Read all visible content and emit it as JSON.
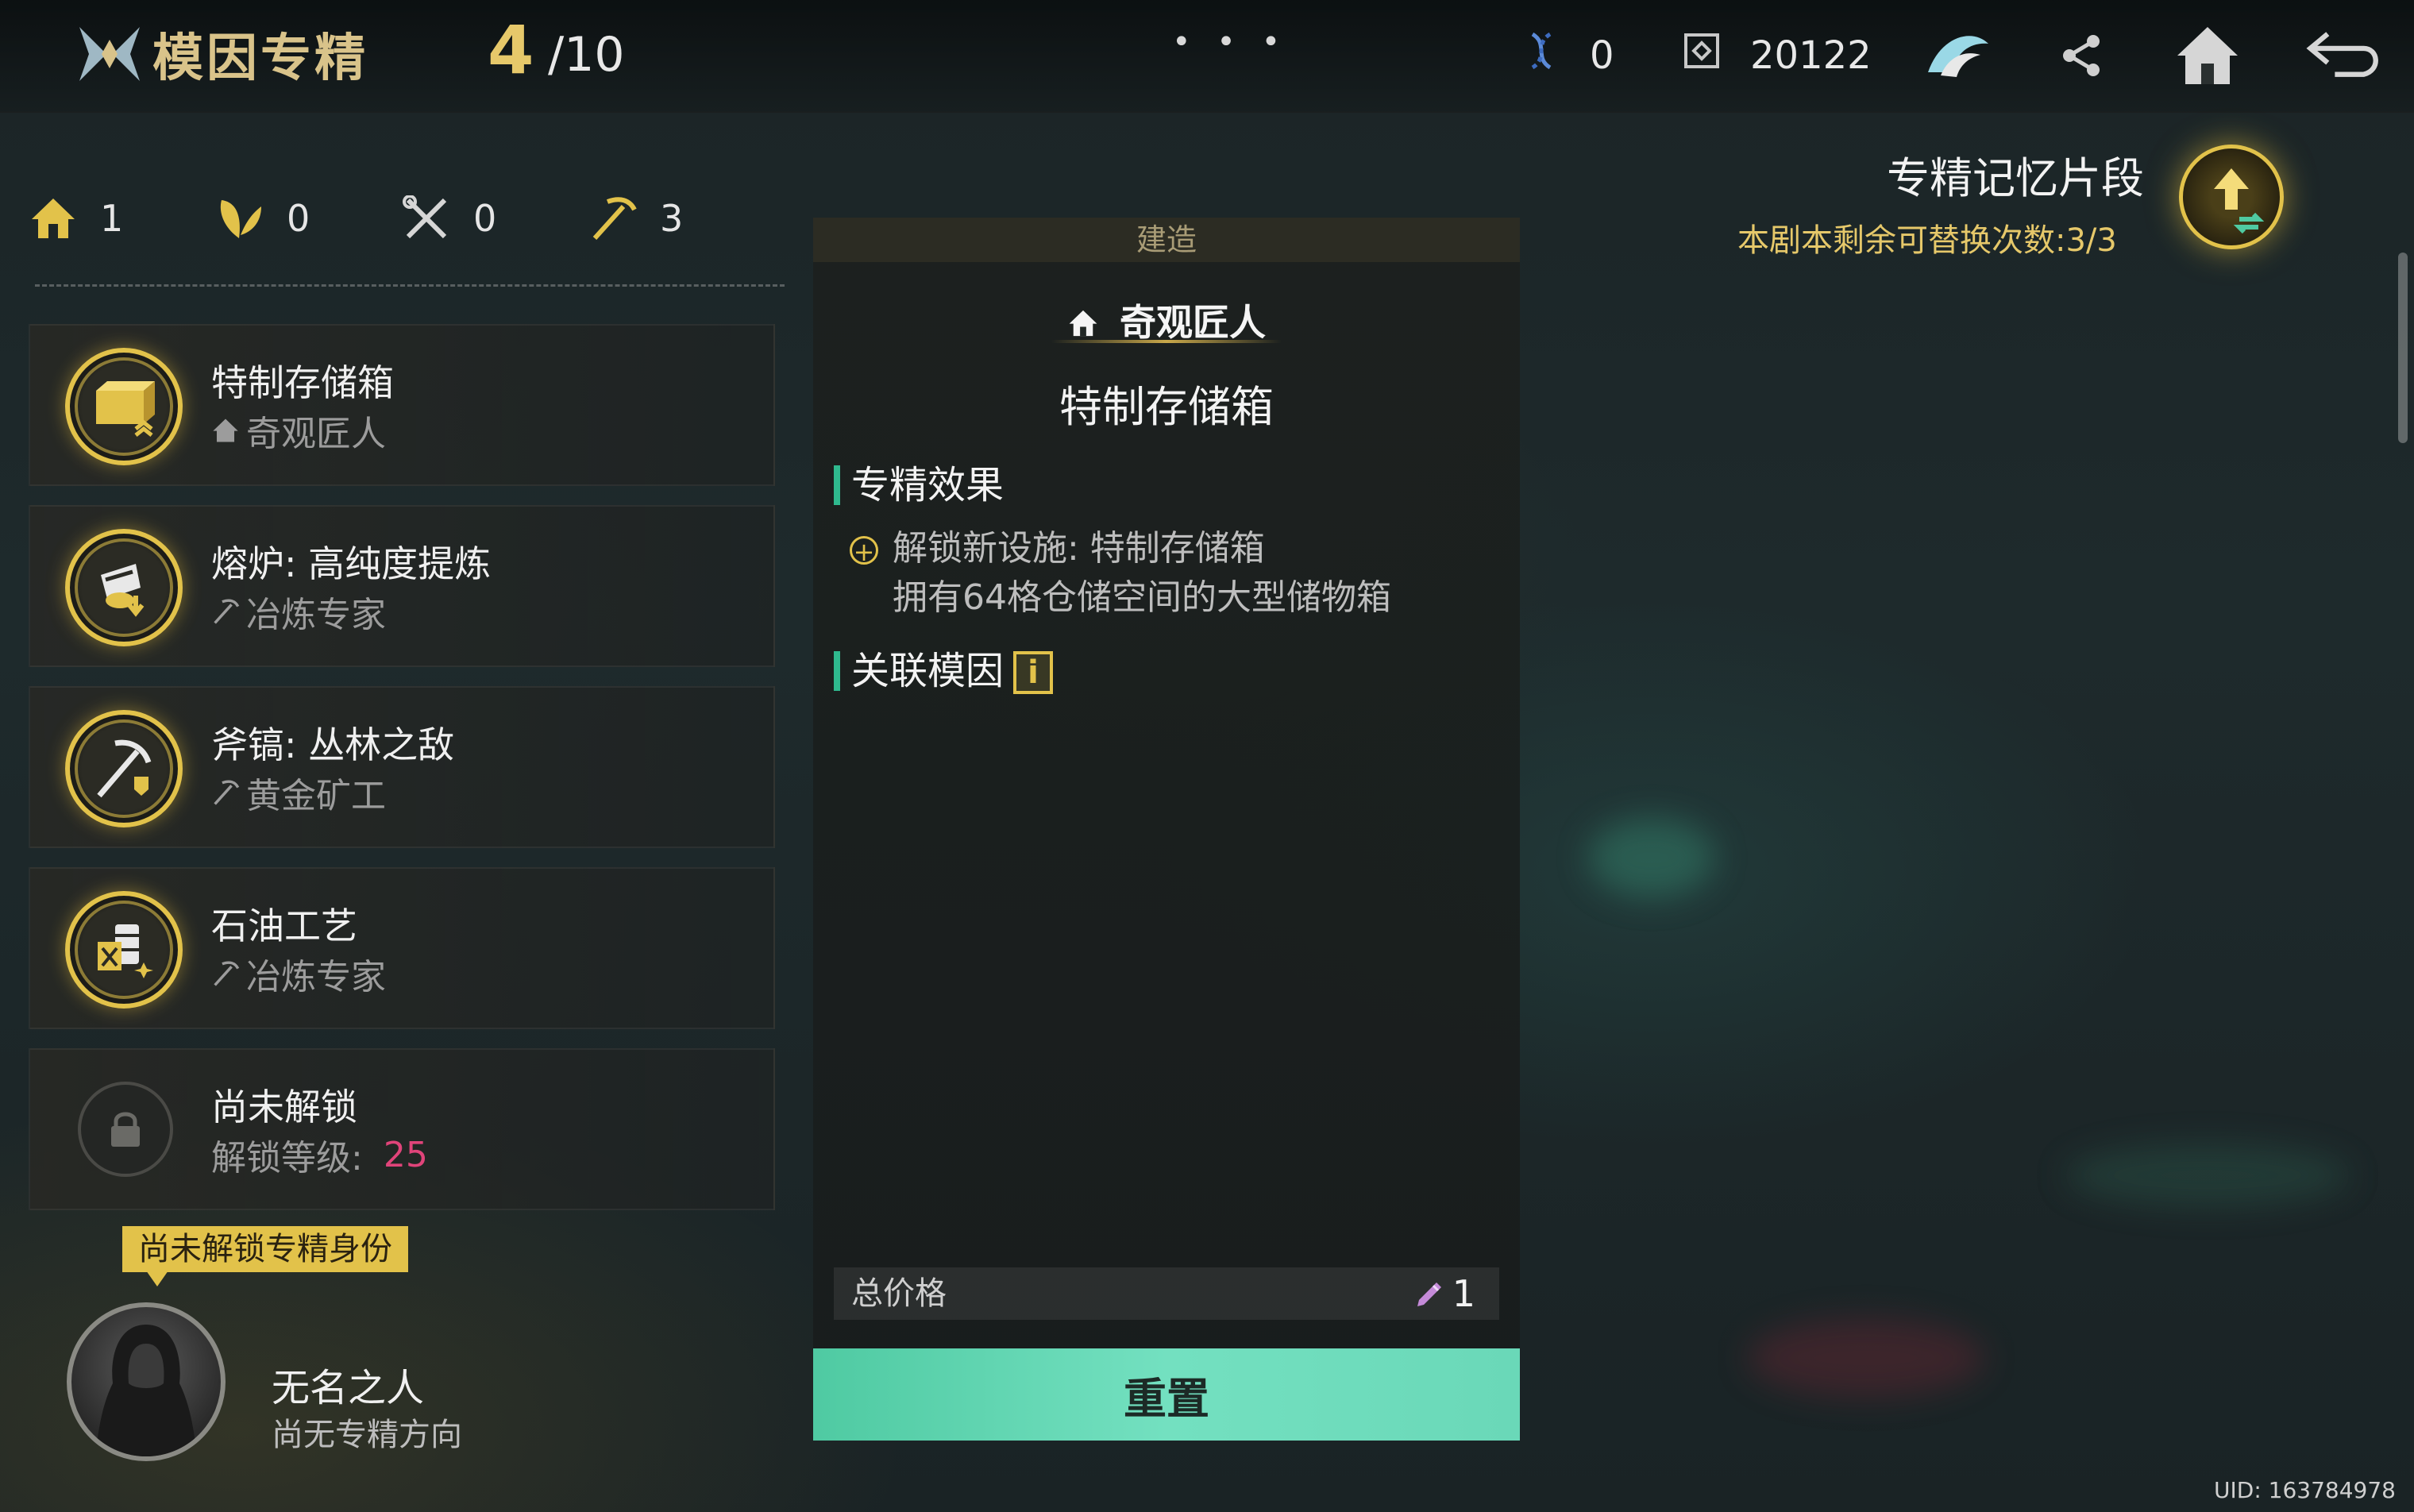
{
  "header": {
    "title": "模因专精",
    "progress_current": "4",
    "progress_total": "/10",
    "more_label": "• • •",
    "resource_dna_count": "0",
    "resource_coin_count": "20122"
  },
  "categories": [
    {
      "icon": "house-icon",
      "count": "1"
    },
    {
      "icon": "leaf-icon",
      "count": "0"
    },
    {
      "icon": "tools-icon",
      "count": "0"
    },
    {
      "icon": "pickaxe-icon",
      "count": "3"
    }
  ],
  "specializations": [
    {
      "name": "特制存储箱",
      "profession": "奇观匠人",
      "icon": "storage-box-icon",
      "prof_icon": "house-icon"
    },
    {
      "name": "熔炉: 高纯度提炼",
      "profession": "冶炼专家",
      "icon": "furnace-icon",
      "prof_icon": "pickaxe-icon"
    },
    {
      "name": "斧镐: 丛林之敌",
      "profession": "黄金矿工",
      "icon": "axe-pickaxe-icon",
      "prof_icon": "pickaxe-icon"
    },
    {
      "name": "石油工艺",
      "profession": "冶炼专家",
      "icon": "oil-barrel-icon",
      "prof_icon": "pickaxe-icon"
    }
  ],
  "locked_slot": {
    "name": "尚未解锁",
    "level_label": "解锁等级:",
    "level": "25"
  },
  "identity": {
    "tag": "尚未解锁专精身份",
    "name": "无名之人",
    "subtitle": "尚无专精方向"
  },
  "detail": {
    "category": "建造",
    "faction": "奇观匠人",
    "item_name": "特制存储箱",
    "effect_header": "专精效果",
    "effect_line1": "解锁新设施: 特制存储箱",
    "effect_line2": "拥有64格仓储空间的大型储物箱",
    "related_header": "关联模因",
    "info_label": "i",
    "price_label": "总价格",
    "price_value": "1",
    "reset_label": "重置"
  },
  "memory": {
    "title": "专精记忆片段",
    "subtitle": "本剧本剩余可替换次数:3/3"
  },
  "uid": "UID: 163784978",
  "colors": {
    "accent_gold": "#e2c24a",
    "accent_teal": "#4fcaa2",
    "level_red": "#e0447a"
  }
}
